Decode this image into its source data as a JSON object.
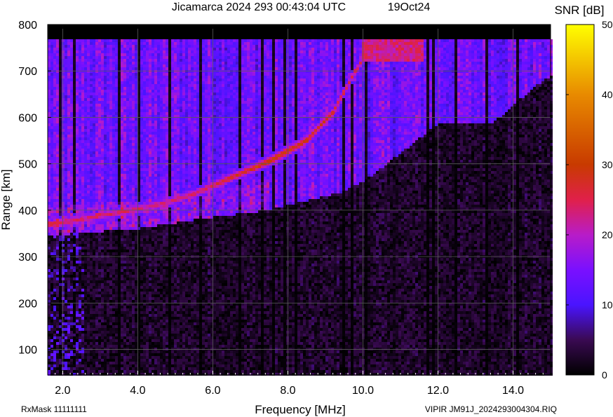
{
  "header": {
    "title": "Jicamarca 2024 293 00:43:04 UTC",
    "date": "19Oct24"
  },
  "footer": {
    "rxmask": "RxMask 11111111",
    "file": "VIPIR  JM91J_2024293004304.RIQ"
  },
  "chart_data": {
    "type": "heatmap",
    "title": "Jicamarca 2024 293 00:43:04 UTC",
    "xlabel": "Frequency [MHz]",
    "ylabel": "Range [km]",
    "colorbar_label": "SNR [dB]",
    "xlim": [
      1.6,
      15.0
    ],
    "ylim": [
      45,
      800
    ],
    "data_ymax": 768,
    "xticks": [
      2.0,
      4.0,
      6.0,
      8.0,
      10.0,
      12.0,
      14.0
    ],
    "xtick_labels": [
      "2.0",
      "4.0",
      "6.0",
      "8.0",
      "10.0",
      "12.0",
      "14.0"
    ],
    "yticks": [
      100,
      200,
      300,
      400,
      500,
      600,
      700,
      800
    ],
    "ytick_labels": [
      "100",
      "200",
      "300",
      "400",
      "500",
      "600",
      "700",
      "800"
    ],
    "colorbar_ticks": [
      0,
      10,
      20,
      30,
      40,
      50
    ],
    "colorbar_tick_labels": [
      "0",
      "10",
      "20",
      "30",
      "40",
      "50"
    ],
    "colorbar_range": [
      0,
      50
    ],
    "grid": true,
    "colormap_stops": [
      {
        "v": 0,
        "color": "#000000"
      },
      {
        "v": 5,
        "color": "#3a0a52"
      },
      {
        "v": 10,
        "color": "#4a14ff"
      },
      {
        "v": 15,
        "color": "#7a10ff"
      },
      {
        "v": 20,
        "color": "#b81cc8"
      },
      {
        "v": 25,
        "color": "#e0204a"
      },
      {
        "v": 30,
        "color": "#c83a00"
      },
      {
        "v": 40,
        "color": "#e88a00"
      },
      {
        "v": 50,
        "color": "#ffff00"
      }
    ],
    "echo_trace": [
      {
        "f": 1.7,
        "range": 370,
        "snr": 26
      },
      {
        "f": 2.5,
        "range": 380,
        "snr": 24
      },
      {
        "f": 3.5,
        "range": 395,
        "snr": 24
      },
      {
        "f": 4.5,
        "range": 410,
        "snr": 23
      },
      {
        "f": 5.5,
        "range": 435,
        "snr": 24
      },
      {
        "f": 6.5,
        "range": 470,
        "snr": 27
      },
      {
        "f": 7.5,
        "range": 505,
        "snr": 30
      },
      {
        "f": 8.5,
        "range": 550,
        "snr": 29
      },
      {
        "f": 9.2,
        "range": 610,
        "snr": 27
      },
      {
        "f": 9.8,
        "range": 700,
        "snr": 25
      },
      {
        "f": 10.2,
        "range": 750,
        "snr": 24
      }
    ],
    "background_onset": [
      {
        "f": 1.6,
        "range": 345
      },
      {
        "f": 4.0,
        "range": 360
      },
      {
        "f": 6.0,
        "range": 385
      },
      {
        "f": 7.5,
        "range": 400
      },
      {
        "f": 9.5,
        "range": 440
      },
      {
        "f": 10.0,
        "range": 460
      },
      {
        "f": 12.0,
        "range": 585
      },
      {
        "f": 13.5,
        "range": 590
      },
      {
        "f": 14.5,
        "range": 660
      },
      {
        "f": 15.0,
        "range": 690
      }
    ],
    "dark_columns_mhz": [
      1.95,
      2.3,
      3.5,
      4.05,
      4.85,
      5.7,
      6.75,
      7.3,
      7.65,
      7.95,
      8.2,
      9.5,
      9.7,
      10.05,
      11.7,
      11.9,
      12.5,
      13.3,
      14.15
    ]
  }
}
